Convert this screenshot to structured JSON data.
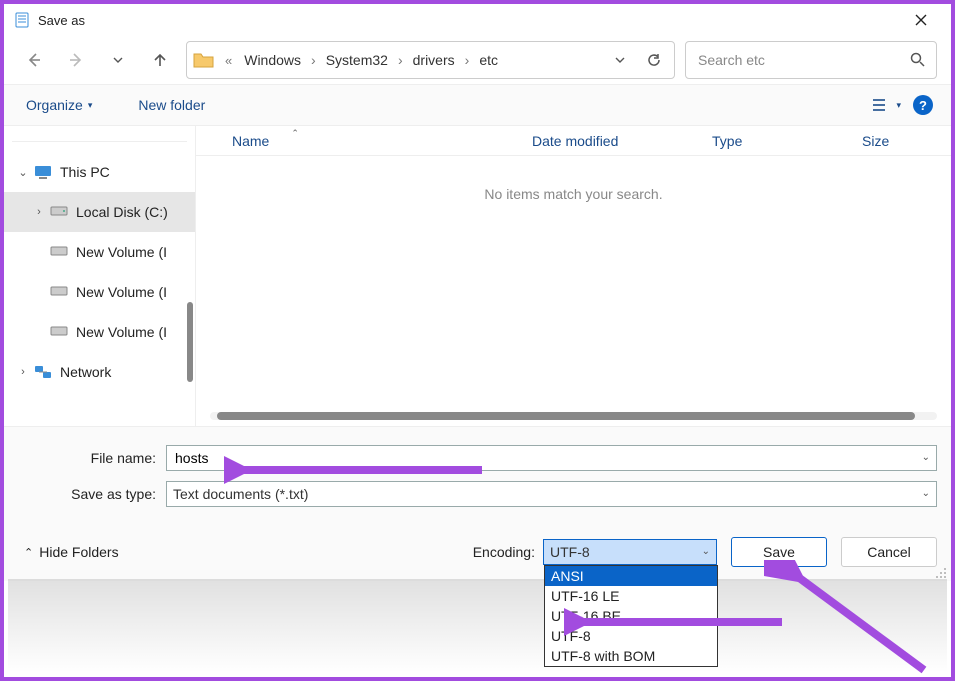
{
  "window": {
    "title": "Save as"
  },
  "breadcrumb": {
    "segments": [
      "Windows",
      "System32",
      "drivers",
      "etc"
    ]
  },
  "search": {
    "placeholder": "Search etc"
  },
  "commands": {
    "organize": "Organize",
    "new_folder": "New folder"
  },
  "tree": {
    "this_pc": "This PC",
    "items": [
      {
        "label": "Local Disk (C:)",
        "expandable": true,
        "active": true,
        "icon": "disk"
      },
      {
        "label": "New Volume (I",
        "expandable": false,
        "icon": "disk"
      },
      {
        "label": "New Volume (I",
        "expandable": false,
        "icon": "disk"
      },
      {
        "label": "New Volume (I",
        "expandable": false,
        "icon": "disk"
      }
    ],
    "network": "Network"
  },
  "columns": {
    "name": "Name",
    "date": "Date modified",
    "type": "Type",
    "size": "Size"
  },
  "filepane": {
    "empty_message": "No items match your search."
  },
  "form": {
    "filename_label": "File name:",
    "filename_value": "hosts",
    "saveas_label": "Save as type:",
    "saveas_value": "Text documents (*.txt)"
  },
  "footer": {
    "hide_folders": "Hide Folders",
    "encoding_label": "Encoding:",
    "encoding_value": "UTF-8",
    "encoding_options": [
      "ANSI",
      "UTF-16 LE",
      "UTF-16 BE",
      "UTF-8",
      "UTF-8 with BOM"
    ],
    "save": "Save",
    "cancel": "Cancel"
  }
}
